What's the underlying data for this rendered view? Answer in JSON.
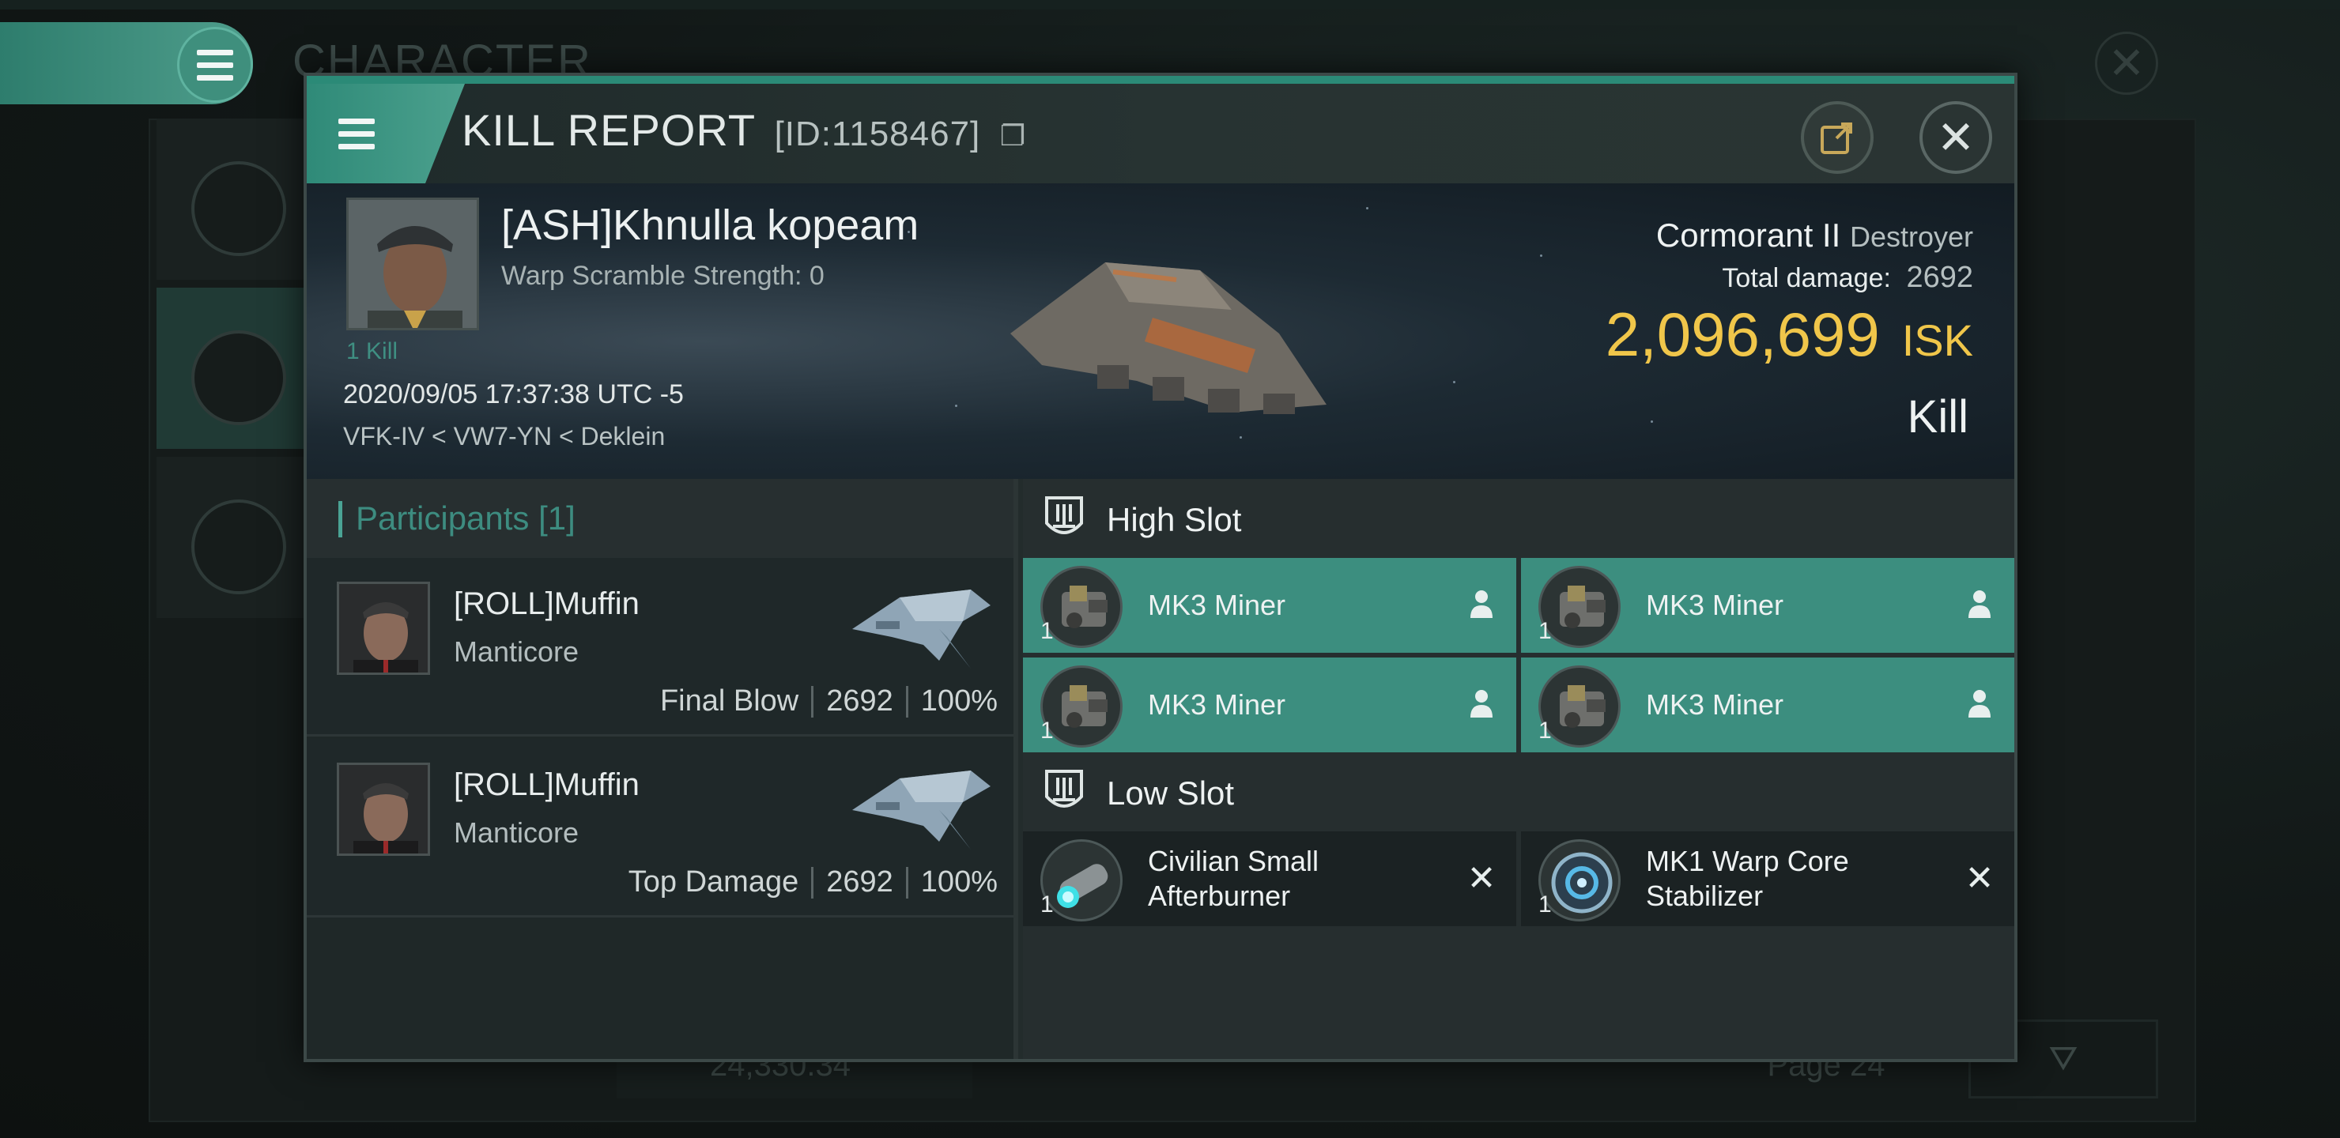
{
  "background": {
    "title": "CHARACTER",
    "bottom_value": "24,330.34",
    "page_label": "Page 24"
  },
  "window": {
    "title": "KILL REPORT",
    "id": "[ID:1158467]",
    "icons": {
      "menu": "menu-icon",
      "copy": "copy-icon",
      "share": "share-icon",
      "close": "close-icon"
    }
  },
  "victim": {
    "name": "[ASH]Khnulla kopeam",
    "warp_scramble": "Warp Scramble Strength: 0",
    "kill_count": "1 Kill",
    "timestamp": "2020/09/05 17:37:38 UTC -5",
    "location": "VFK-IV < VW7-YN < Deklein",
    "ship_name": "Cormorant II",
    "ship_class": "Destroyer",
    "total_damage_label": "Total damage:",
    "total_damage": "2692",
    "isk_value": "2,096,699",
    "isk_unit": "ISK",
    "result": "Kill"
  },
  "participants": {
    "title": "Participants [1]",
    "rows": [
      {
        "name": "[ROLL]Muffin",
        "ship": "Manticore",
        "label": "Final Blow",
        "damage": "2692",
        "percent": "100%"
      },
      {
        "name": "[ROLL]Muffin",
        "ship": "Manticore",
        "label": "Top Damage",
        "damage": "2692",
        "percent": "100%"
      }
    ]
  },
  "slots": {
    "high": {
      "title": "High Slot",
      "modules": [
        {
          "name": "MK3 Miner",
          "qty": "1",
          "state": "fitted"
        },
        {
          "name": "MK3 Miner",
          "qty": "1",
          "state": "fitted"
        },
        {
          "name": "MK3 Miner",
          "qty": "1",
          "state": "fitted"
        },
        {
          "name": "MK3 Miner",
          "qty": "1",
          "state": "fitted"
        }
      ]
    },
    "low": {
      "title": "Low Slot",
      "modules": [
        {
          "name": "Civilian Small Afterburner",
          "qty": "1",
          "state": "destroyed"
        },
        {
          "name": "MK1 Warp Core Stabilizer",
          "qty": "1",
          "state": "destroyed"
        }
      ]
    }
  },
  "colors": {
    "accent": "#3c8e7f",
    "isk": "#f0c64a",
    "participants_title": "#3d8c80"
  }
}
